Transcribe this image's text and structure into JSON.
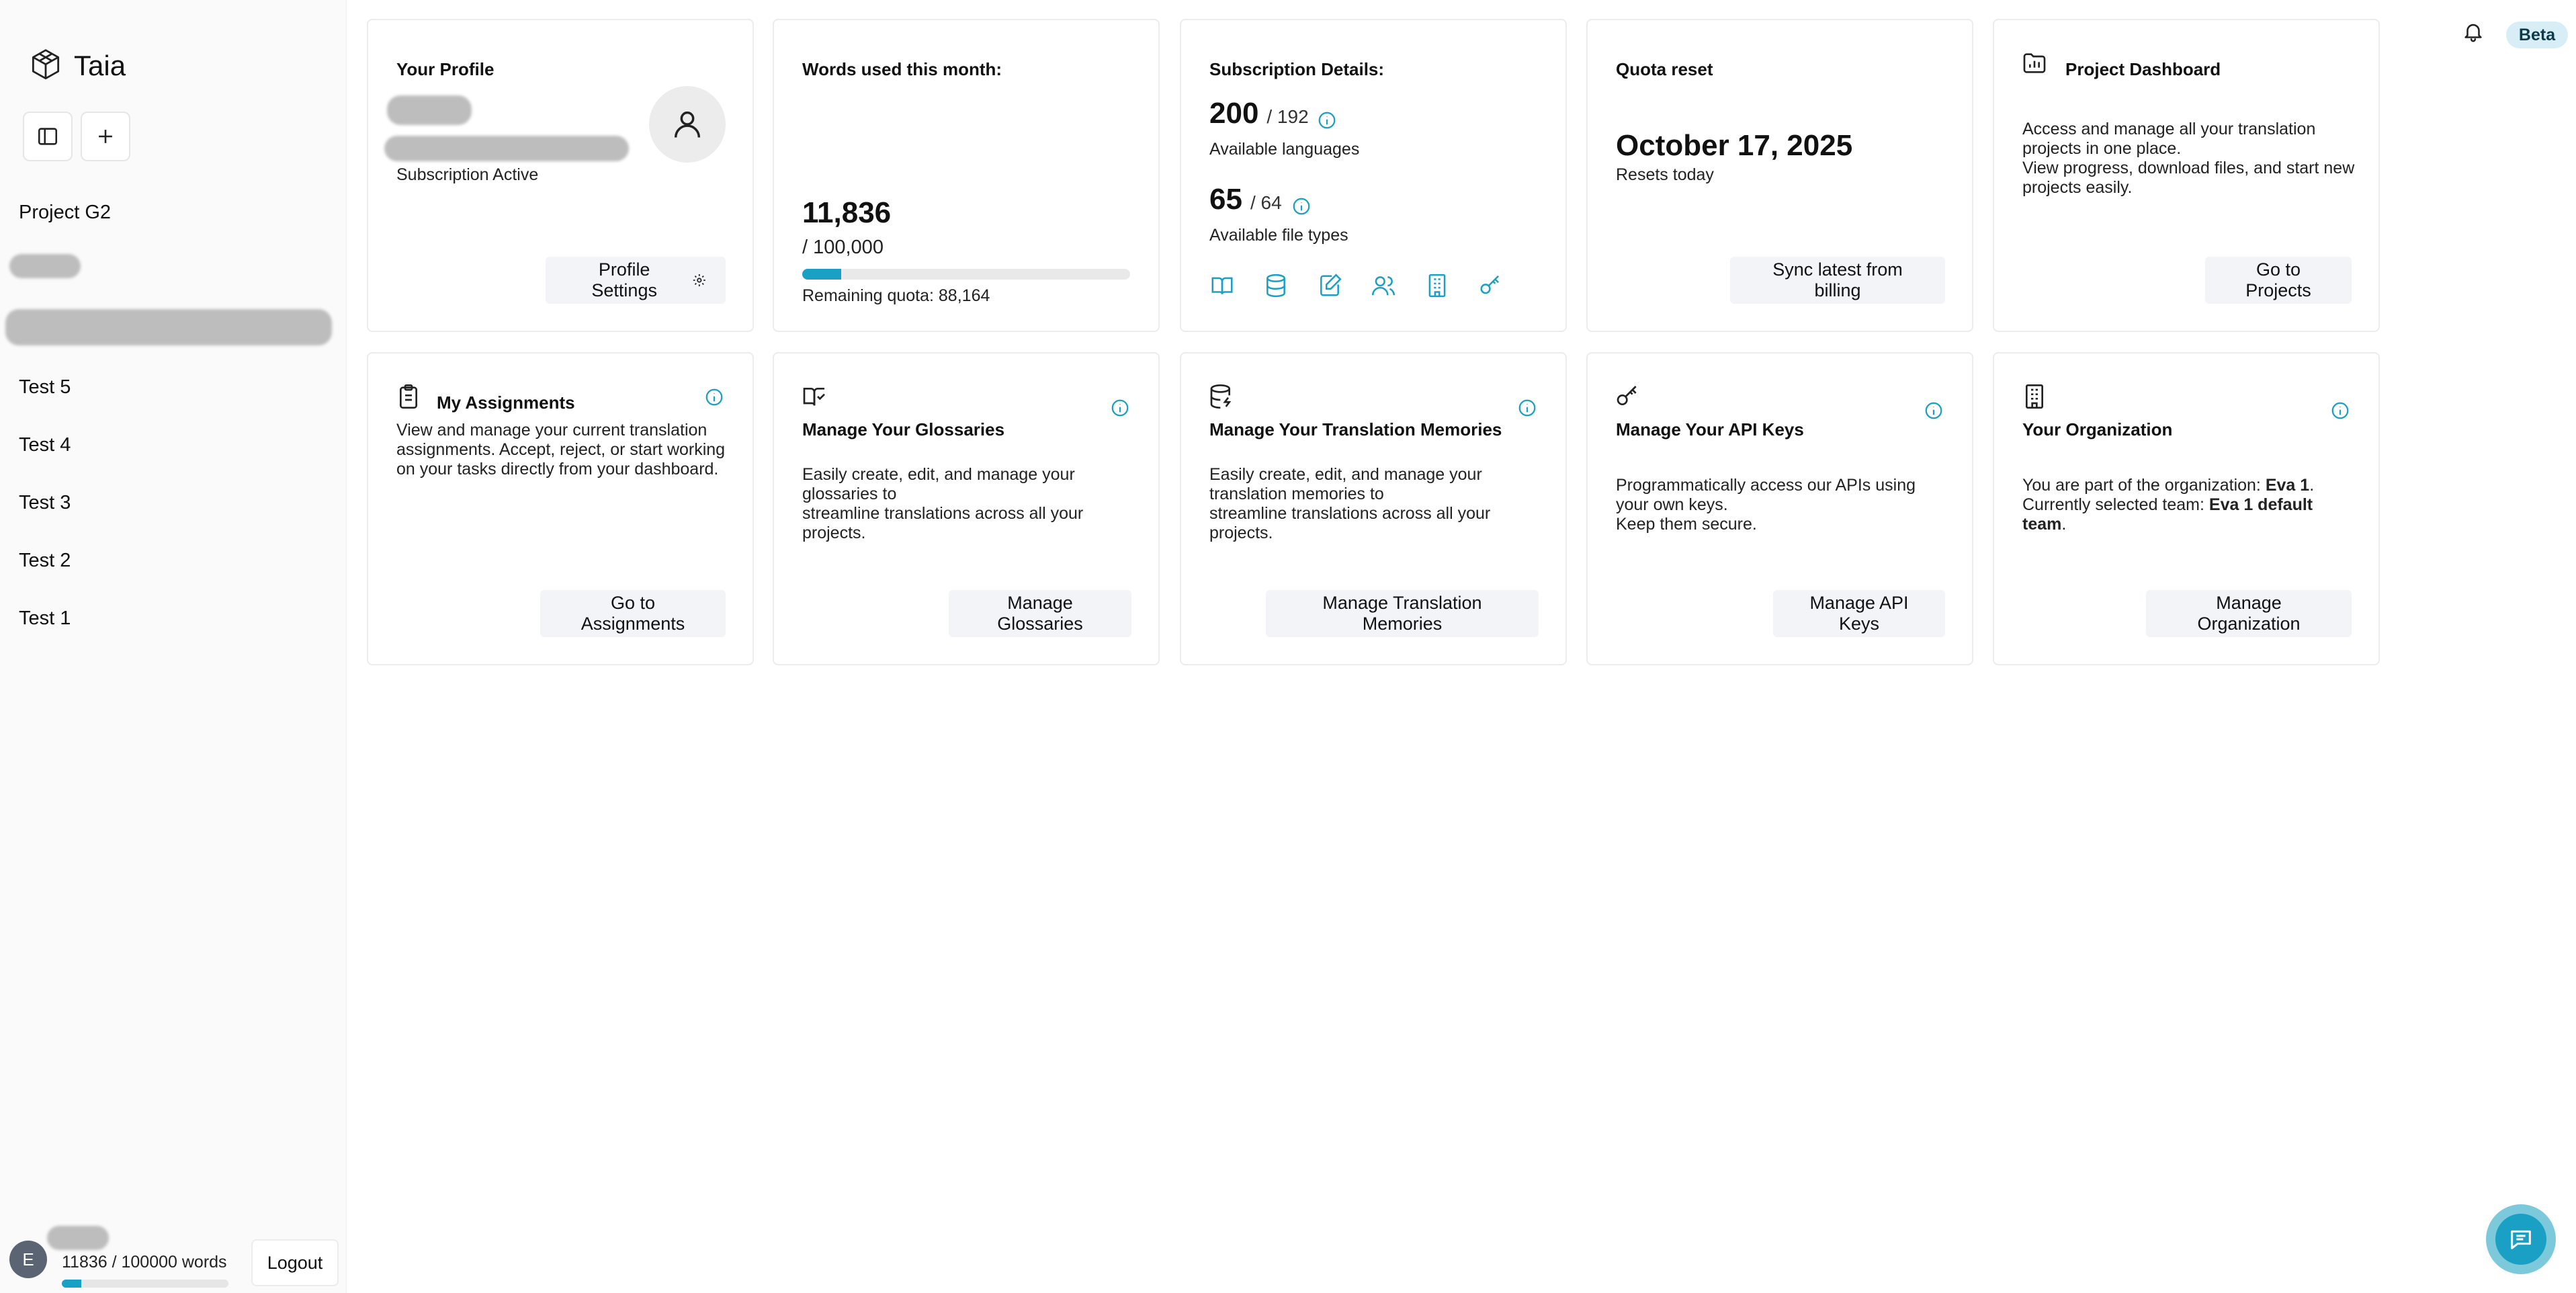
{
  "app": {
    "name": "Taia"
  },
  "sidebar": {
    "items": [
      {
        "label": "Project G2"
      },
      {
        "label": "Test 5"
      },
      {
        "label": "Test 4"
      },
      {
        "label": "Test 3"
      },
      {
        "label": "Test 2"
      },
      {
        "label": "Test 1"
      }
    ],
    "footer": {
      "avatar_initial": "E",
      "usage_text": "11836 / 100000 words",
      "usage_fraction": 0.118,
      "logout_label": "Logout"
    }
  },
  "header": {
    "badge": "Beta"
  },
  "cards": {
    "profile": {
      "title": "Your Profile",
      "status": "Subscription Active",
      "button": "Profile Settings"
    },
    "words": {
      "title": "Words used this month:",
      "used": "11,836",
      "limit": "/ 100,000",
      "used_fraction": 0.118,
      "remaining": "Remaining quota: 88,164"
    },
    "subscription": {
      "title": "Subscription Details:",
      "languages_count": "200",
      "languages_total": "/ 192",
      "languages_label": "Available languages",
      "filetypes_count": "65",
      "filetypes_total": "/ 64",
      "filetypes_label": "Available file types"
    },
    "quota": {
      "title": "Quota reset",
      "date": "October 17, 2025",
      "sub": "Resets today",
      "button": "Sync latest from billing"
    },
    "projects": {
      "title": "Project Dashboard",
      "desc_1": "Access and manage all your translation projects in one place.",
      "desc_2": "View progress, download files, and start new projects easily.",
      "button": "Go to Projects"
    },
    "assignments": {
      "title": "My Assignments",
      "desc": "View and manage your current translation assignments. Accept, reject, or start working on your tasks directly from your dashboard.",
      "button": "Go to Assignments"
    },
    "glossaries": {
      "title": "Manage Your Glossaries",
      "desc_1": "Easily create, edit, and manage your glossaries to",
      "desc_2": "streamline translations across all your projects.",
      "button": "Manage Glossaries"
    },
    "memories": {
      "title": "Manage Your Translation Memories",
      "desc_1": "Easily create, edit, and manage your translation memories to",
      "desc_2": "streamline translations across all your projects.",
      "button": "Manage Translation Memories"
    },
    "api": {
      "title": "Manage Your API Keys",
      "desc_1": "Programmatically access our APIs using your own keys.",
      "desc_2": "Keep them secure.",
      "button": "Manage API Keys"
    },
    "organization": {
      "title": "Your Organization",
      "line1_prefix": "You are part of the organization: ",
      "org_name": "Eva 1",
      "line1_suffix": ".",
      "line2_prefix": "Currently selected team: ",
      "team_name": "Eva 1 default team",
      "line2_suffix": ".",
      "button": "Manage Organization"
    }
  }
}
